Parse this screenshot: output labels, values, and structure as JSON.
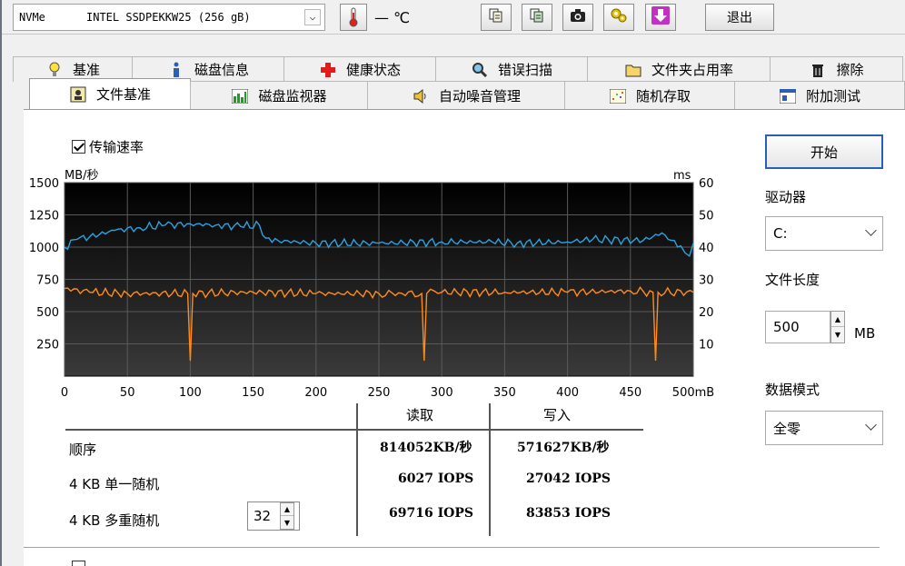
{
  "toolbar": {
    "drive_name": "NVMe",
    "drive_model": "INTEL SSDPEKKW25 (256 gB)",
    "temperature": "— ℃",
    "exit_label": "退出"
  },
  "tabs_row1": [
    {
      "label": "基准",
      "icon": "bulb-icon"
    },
    {
      "label": "磁盘信息",
      "icon": "info-icon"
    },
    {
      "label": "健康状态",
      "icon": "cross-icon"
    },
    {
      "label": "错误扫描",
      "icon": "magnifier-icon"
    },
    {
      "label": "文件夹占用率",
      "icon": "folder-icon"
    },
    {
      "label": "擦除",
      "icon": "trash-icon"
    }
  ],
  "tabs_row2": [
    {
      "label": "文件基准",
      "icon": "file-bench-icon",
      "active": true
    },
    {
      "label": "磁盘监视器",
      "icon": "bar-chart-icon"
    },
    {
      "label": "自动噪音管理",
      "icon": "speaker-icon"
    },
    {
      "label": "随机存取",
      "icon": "scatter-icon"
    },
    {
      "label": "附加测试",
      "icon": "window-icon"
    }
  ],
  "transfer_rate_label": "传输速率",
  "chart_data": {
    "type": "line",
    "ylabel_left": "MB/秒",
    "ylabel_right": "ms",
    "x_unit": "500mB",
    "xlim": [
      0,
      500
    ],
    "ylim_left": [
      0,
      1500
    ],
    "ylim_right": [
      0,
      60
    ],
    "x_ticks": [
      0,
      50,
      100,
      150,
      200,
      250,
      300,
      350,
      400,
      450,
      500
    ],
    "y_ticks_left": [
      250,
      500,
      750,
      1000,
      1250,
      1500
    ],
    "y_ticks_right": [
      10,
      20,
      30,
      40,
      50,
      60
    ],
    "series": [
      {
        "color": "#2aa3e0",
        "x": [
          0,
          10,
          20,
          40,
          60,
          80,
          100,
          120,
          140,
          155,
          160,
          170,
          200,
          250,
          300,
          340,
          360,
          400,
          420,
          460,
          475,
          480,
          490,
          497,
          500
        ],
        "y": [
          1000,
          1060,
          1080,
          1130,
          1150,
          1170,
          1180,
          1170,
          1160,
          1170,
          1070,
          1050,
          1030,
          1030,
          1040,
          1040,
          1030,
          1040,
          1060,
          1050,
          1110,
          1060,
          1010,
          930,
          1030
        ]
      },
      {
        "color": "#ff8c1a",
        "x": [
          0,
          20,
          50,
          98,
          100,
          102,
          150,
          200,
          250,
          284,
          286,
          288,
          300,
          350,
          400,
          450,
          468,
          470,
          472,
          500
        ],
        "y": [
          680,
          650,
          640,
          640,
          120,
          640,
          650,
          640,
          640,
          640,
          120,
          640,
          650,
          650,
          650,
          660,
          650,
          120,
          650,
          650
        ]
      }
    ]
  },
  "results": {
    "col_read": "读取",
    "col_write": "写入",
    "rows": [
      {
        "label": "顺序",
        "read": "814052KB/秒",
        "write": "571627KB/秒"
      },
      {
        "label": "4 KB 单一随机",
        "read": "6027 IOPS",
        "write": "27042 IOPS"
      },
      {
        "label": "4 KB 多重随机",
        "read": "69716 IOPS",
        "write": "83853 IOPS"
      }
    ],
    "queue_depth": "32"
  },
  "right_panel": {
    "start_label": "开始",
    "drive_label": "驱动器",
    "drive_value": "C:",
    "file_length_label": "文件长度",
    "file_length_value": "500",
    "file_length_unit": "MB",
    "data_mode_label": "数据模式",
    "data_mode_value": "全零"
  }
}
